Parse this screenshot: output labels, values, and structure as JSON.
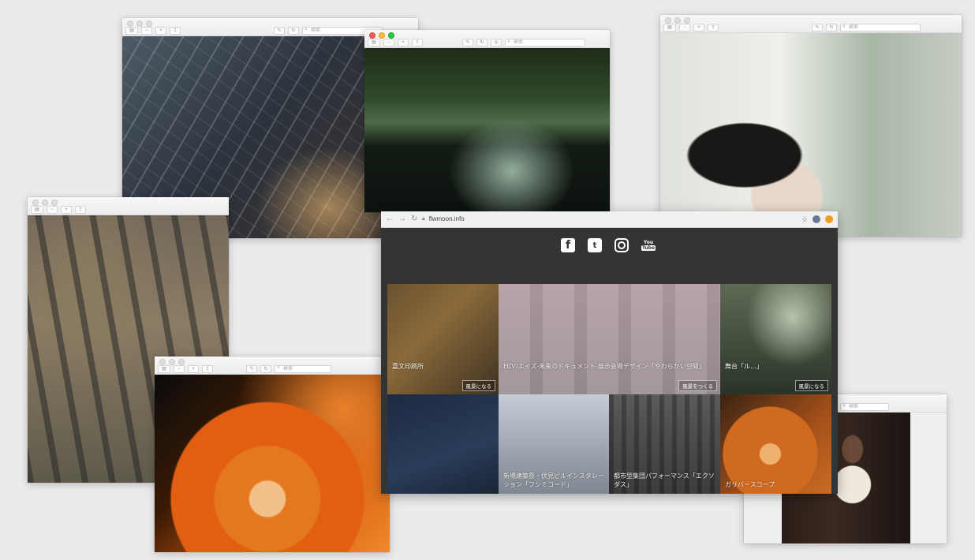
{
  "preview_toolbar": {
    "search_placeholder": "検索",
    "pen_glyph": "✎",
    "zoom_out_glyph": "−",
    "zoom_in_glyph": "+",
    "share_glyph": "⇪",
    "rotate_glyph": "↻",
    "annotate_glyph": "◎"
  },
  "windows": [
    {
      "id": "arch",
      "photo": "glass-arcade-bokeh"
    },
    {
      "id": "pond",
      "photo": "forest-pond-lilies",
      "traffic_lights": "color"
    },
    {
      "id": "hands",
      "photo": "child-and-adult-reaching"
    },
    {
      "id": "chains",
      "photo": "miniature-figures-on-chain"
    },
    {
      "id": "flower",
      "photo": "figures-on-orange-flower"
    },
    {
      "id": "portrait",
      "photo": "man-in-white-shirt"
    }
  ],
  "browser": {
    "url": "flwmoon.info",
    "nav": {
      "back": "←",
      "forward": "→",
      "reload": "↻"
    },
    "bookmark_glyph": "☆",
    "social": [
      {
        "name": "facebook",
        "glyph": "f"
      },
      {
        "name": "twitter",
        "glyph": "t"
      },
      {
        "name": "instagram",
        "glyph": ""
      },
      {
        "name": "youtube",
        "top": "You",
        "bottom": "Tube"
      }
    ],
    "tiles": [
      {
        "caption": "嘉文印刷所",
        "button": "風景になる"
      },
      {
        "caption": "HIV/エイズ-未来のドキュメント-展示会場デザイン「やわらかい空間」",
        "button": "風景をつくる"
      },
      {
        "caption": "舞台「ル…」",
        "button": "風景になる"
      },
      {
        "caption": ""
      },
      {
        "caption": "新場建築祭・伏見ビルインスタレーション「フシミコード」"
      },
      {
        "caption": "都市型集団パフォーマンス「エクソダス」"
      },
      {
        "caption": "ガリバースコープ"
      }
    ]
  }
}
